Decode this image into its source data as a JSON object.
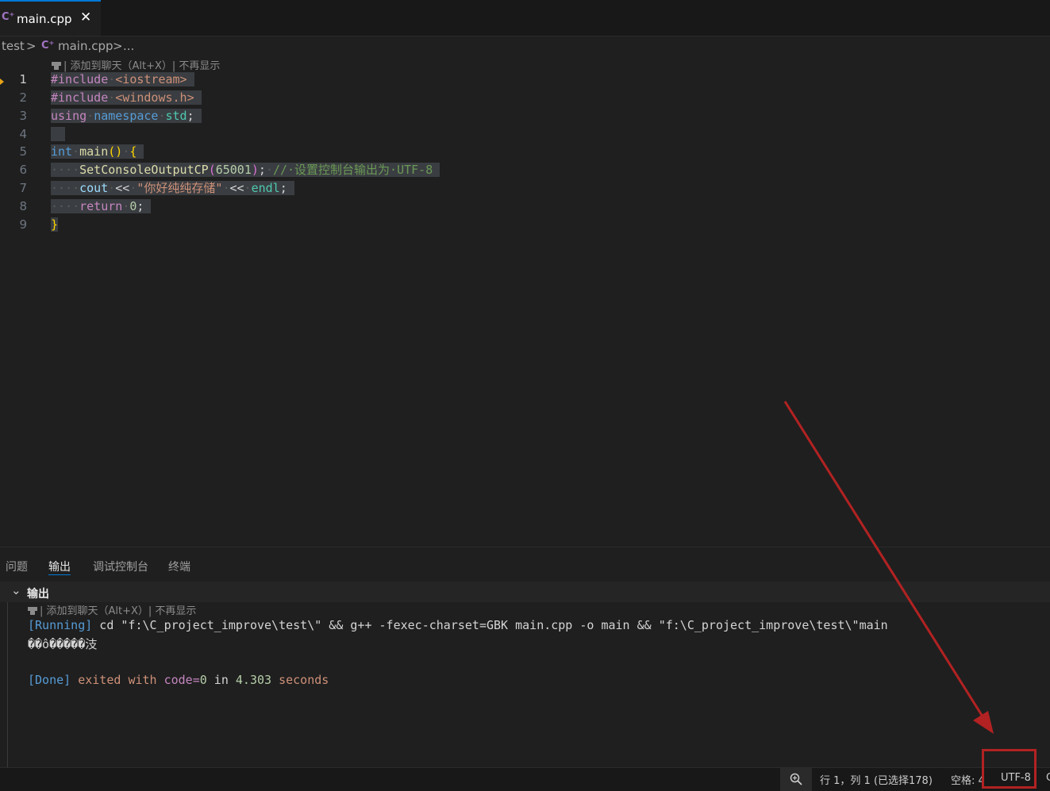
{
  "tab": {
    "filename": "main.cpp",
    "close": "✕",
    "icon": "C⁺"
  },
  "breadcrumb": {
    "folder": "test",
    "sep": ">",
    "file": "main.cpp",
    "more": "..."
  },
  "hint_editor": "| 添加到聊天（Alt+X）| 不再显示",
  "editor": {
    "line_numbers": [
      "1",
      "2",
      "3",
      "4",
      "5",
      "6",
      "7",
      "8",
      "9"
    ],
    "active_line": "1"
  },
  "panel": {
    "tabs": [
      "问题",
      "输出",
      "调试控制台",
      "终端"
    ],
    "active_tab": "输出",
    "output_title": "输出",
    "hint": "| 添加到聊天（Alt+X）| 不再显示",
    "running_tag": "[Running]",
    "running_cmd": " cd \"f:\\C_project_improve\\test\\\" && g++ -fexec-charset=GBK main.cpp -o main && \"f:\\C_project_improve\\test\\\"main",
    "garbled": "��ô�����汥",
    "done_tag": "[Done]",
    "done_exited": " exited ",
    "done_with": "with",
    "done_code": " code=",
    "done_code_val": "0",
    "done_in": " in ",
    "done_time": "4.303",
    "done_seconds": " seconds"
  },
  "status": {
    "position": "行 1，列 1 (已选择178)",
    "spaces": "空格: 4",
    "encoding": "UTF-8",
    "trailing": "C"
  },
  "colors": {
    "accent": "#0078d4",
    "annotation": "#b22222"
  }
}
